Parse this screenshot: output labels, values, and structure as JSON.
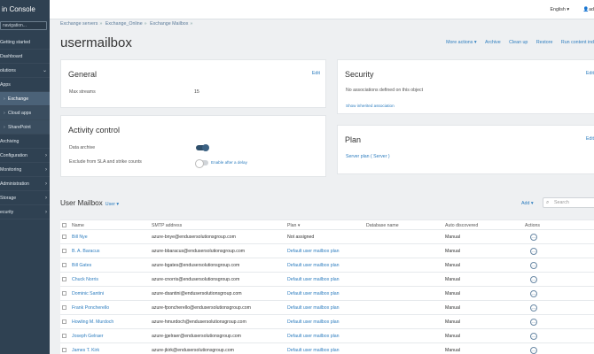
{
  "app": {
    "title": "in Console"
  },
  "sidebar": {
    "search_placeholder": "navigation...",
    "items": [
      {
        "label": "Getting started"
      },
      {
        "label": "Dashboard"
      },
      {
        "label": "olutions"
      },
      {
        "label": "Apps"
      },
      {
        "label": "Exchange"
      },
      {
        "label": "Cloud apps"
      },
      {
        "label": "SharePoint"
      },
      {
        "label": "Archiving"
      },
      {
        "label": "Configuration"
      },
      {
        "label": "Monitoring"
      },
      {
        "label": "Administration"
      },
      {
        "label": "Storage"
      },
      {
        "label": "ecurity"
      }
    ]
  },
  "topbar": {
    "language": "English ▾",
    "user": "ad"
  },
  "breadcrumb": [
    "Exchange servers",
    "Exchange_Online",
    "Exchange Mailbox"
  ],
  "page": {
    "title": "usermailbox"
  },
  "actions": [
    "More actions ▾",
    "Archive",
    "Clean up",
    "Restore",
    "Run content ind"
  ],
  "general": {
    "title": "General",
    "edit": "Edit",
    "max_streams_label": "Max streams",
    "max_streams_value": "15"
  },
  "security": {
    "title": "Security",
    "edit": "Edit",
    "note": "No associations defined on this object",
    "show_inherited": "Show inherited association"
  },
  "activity": {
    "title": "Activity control",
    "data_archive_label": "Data archive",
    "exclude_label": "Exclude from SLA and strike counts",
    "enable_after": "Enable after a delay"
  },
  "plan": {
    "title": "Plan",
    "edit": "Edit",
    "server_plan": "Server plan ( Server )"
  },
  "mailbox_section": {
    "title": "User Mailbox",
    "filter": "User ▾",
    "add": "Add ▾",
    "search_placeholder": "Search"
  },
  "table": {
    "headers": {
      "name": "Name",
      "smtp": "SMTP address",
      "plan": "Plan ▾",
      "db": "Database name",
      "auto": "Auto discovered",
      "actions": "Actions"
    },
    "rows": [
      {
        "name": "Bill Nye",
        "smtp": "azure-bnye@endusersolutionsgroup.com",
        "plan": "Not assigned",
        "auto": "Manual"
      },
      {
        "name": "B. A. Baracus",
        "smtp": "azure-bbaracus@endusersolutionsgroup.com",
        "plan": "Default user mailbox plan",
        "auto": "Manual"
      },
      {
        "name": "Bill Gates",
        "smtp": "azure-bgates@endusersolutionsgroup.com",
        "plan": "Default user mailbox plan",
        "auto": "Manual"
      },
      {
        "name": "Chuck Norris",
        "smtp": "azure-cnorris@endusersolutionsgroup.com",
        "plan": "Default user mailbox plan",
        "auto": "Manual"
      },
      {
        "name": "Dominic Santini",
        "smtp": "azure-dsantini@endusersolutionsgroup.com",
        "plan": "Default user mailbox plan",
        "auto": "Manual"
      },
      {
        "name": "Frank Poncherello",
        "smtp": "azure-fponcherello@endusersolutionsgroup.com",
        "plan": "Default user mailbox plan",
        "auto": "Manual"
      },
      {
        "name": "Howling M. Murdoch",
        "smtp": "azure-hmurdoch@endusersolutionsgroup.com",
        "plan": "Default user mailbox plan",
        "auto": "Manual"
      },
      {
        "name": "Joseph Gelraer",
        "smtp": "azure-jgelraer@endusersolutionsgroup.com",
        "plan": "Default user mailbox plan",
        "auto": "Manual"
      },
      {
        "name": "James T. Kirk",
        "smtp": "azure-jkirk@endusersolutionsgroup.com",
        "plan": "Default user mailbox plan",
        "auto": "Manual"
      }
    ]
  }
}
